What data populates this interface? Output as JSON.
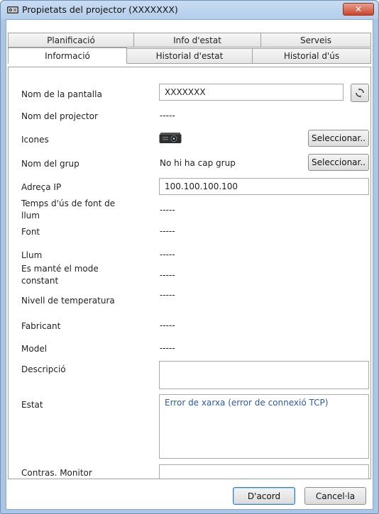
{
  "window": {
    "title": "Propietats del projector (XXXXXXX)",
    "close_label": "✕"
  },
  "tabs": {
    "row_back": [
      "Planificació",
      "Info d'estat",
      "Serveis"
    ],
    "row_front": [
      "Informació",
      "Historial d'estat",
      "Historial d'ús"
    ],
    "active": "Informació"
  },
  "fields": {
    "display_name": {
      "label": "Nom de la pantalla",
      "value": "XXXXXXX"
    },
    "projector_name": {
      "label": "Nom del projector",
      "value": "-----"
    },
    "icons": {
      "label": "Icones",
      "select_label": "Seleccionar.."
    },
    "group_name": {
      "label": "Nom del grup",
      "value": "No hi ha cap grup",
      "select_label": "Seleccionar.."
    },
    "ip_address": {
      "label": "Adreça IP",
      "value": "100.100.100.100"
    },
    "light_hours": {
      "label_line1": "Temps d'ús de font de",
      "label_line2": "llum",
      "value": "-----"
    },
    "source": {
      "label": "Font",
      "value": "-----"
    },
    "light": {
      "label": "Llum",
      "value": "-----"
    },
    "constant_mode": {
      "label_line1": "Es manté el mode",
      "label_line2": "constant",
      "value": "-----"
    },
    "temperature": {
      "label": "Nivell de temperatura",
      "value": "-----"
    },
    "manufacturer": {
      "label": "Fabricant",
      "value": "-----"
    },
    "model": {
      "label": "Model",
      "value": "-----"
    },
    "description": {
      "label": "Descripció",
      "value": ""
    },
    "status": {
      "label": "Estat",
      "value": "Error de xarxa (error de connexió TCP)"
    },
    "monitor_password": {
      "label": "Contras. Monitor",
      "value": ""
    }
  },
  "footer": {
    "ok_label": "D'acord",
    "cancel_label": "Cancel·la"
  },
  "colors": {
    "status_text": "#2a5aa8",
    "frame": "#a9c6e6",
    "close": "#c9452c"
  }
}
